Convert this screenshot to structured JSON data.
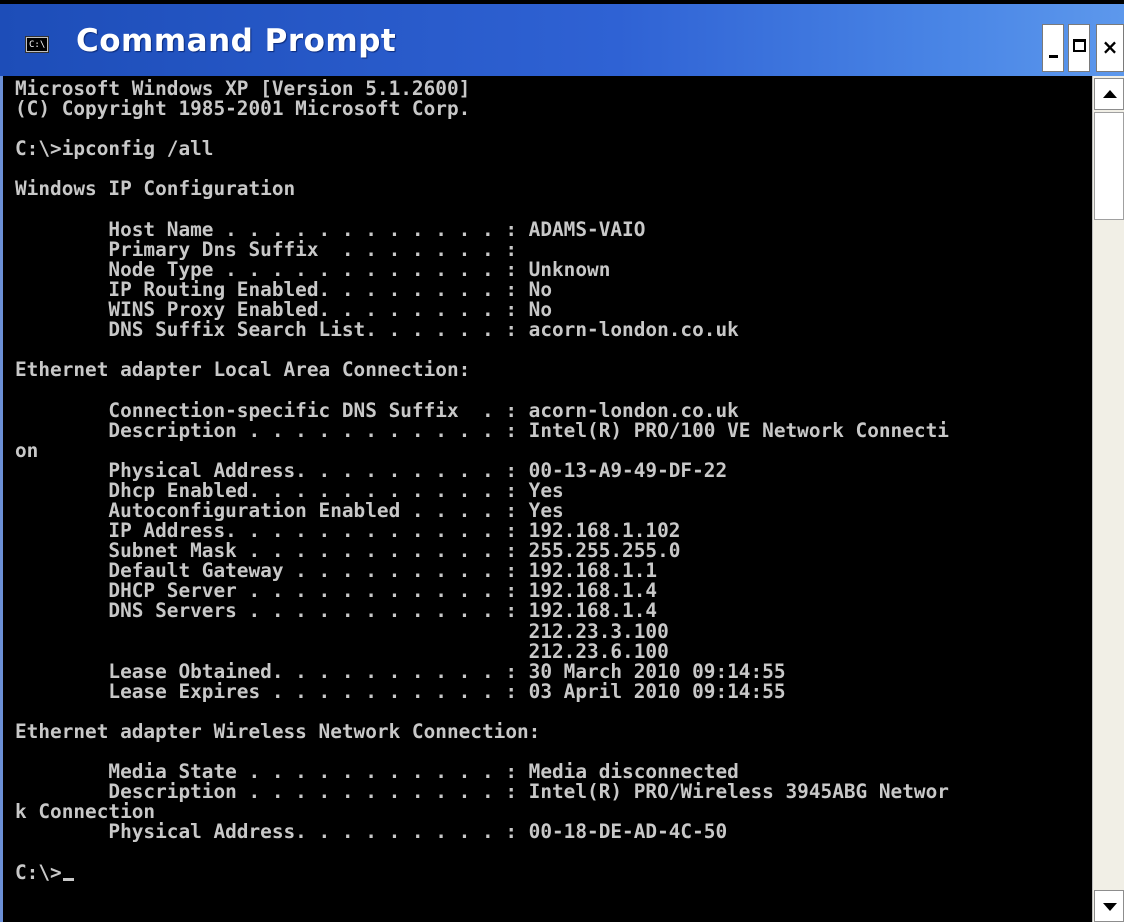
{
  "window": {
    "title": "Command Prompt",
    "icon": "console-icon",
    "icon_text": "C:\\"
  },
  "console": {
    "lines": [
      "Microsoft Windows XP [Version 5.1.2600]",
      "(C) Copyright 1985-2001 Microsoft Corp.",
      "",
      "C:\\>ipconfig /all",
      "",
      "Windows IP Configuration",
      "",
      "        Host Name . . . . . . . . . . . . : ADAMS-VAIO",
      "        Primary Dns Suffix  . . . . . . . :",
      "        Node Type . . . . . . . . . . . . : Unknown",
      "        IP Routing Enabled. . . . . . . . : No",
      "        WINS Proxy Enabled. . . . . . . . : No",
      "        DNS Suffix Search List. . . . . . : acorn-london.co.uk",
      "",
      "Ethernet adapter Local Area Connection:",
      "",
      "        Connection-specific DNS Suffix  . : acorn-london.co.uk",
      "        Description . . . . . . . . . . . : Intel(R) PRO/100 VE Network Connecti",
      "on",
      "        Physical Address. . . . . . . . . : 00-13-A9-49-DF-22",
      "        Dhcp Enabled. . . . . . . . . . . : Yes",
      "        Autoconfiguration Enabled . . . . : Yes",
      "        IP Address. . . . . . . . . . . . : 192.168.1.102",
      "        Subnet Mask . . . . . . . . . . . : 255.255.255.0",
      "        Default Gateway . . . . . . . . . : 192.168.1.1",
      "        DHCP Server . . . . . . . . . . . : 192.168.1.4",
      "        DNS Servers . . . . . . . . . . . : 192.168.1.4",
      "                                            212.23.3.100",
      "                                            212.23.6.100",
      "        Lease Obtained. . . . . . . . . . : 30 March 2010 09:14:55",
      "        Lease Expires . . . . . . . . . . : 03 April 2010 09:14:55",
      "",
      "Ethernet adapter Wireless Network Connection:",
      "",
      "        Media State . . . . . . . . . . . : Media disconnected",
      "        Description . . . . . . . . . . . : Intel(R) PRO/Wireless 3945ABG Networ",
      "k Connection",
      "        Physical Address. . . . . . . . . : 00-18-DE-AD-4C-50",
      "",
      "C:\\>"
    ]
  },
  "colors": {
    "console_bg": "#000000",
    "console_text": "#c8c8c8",
    "titlebar": "#2f62d4"
  }
}
